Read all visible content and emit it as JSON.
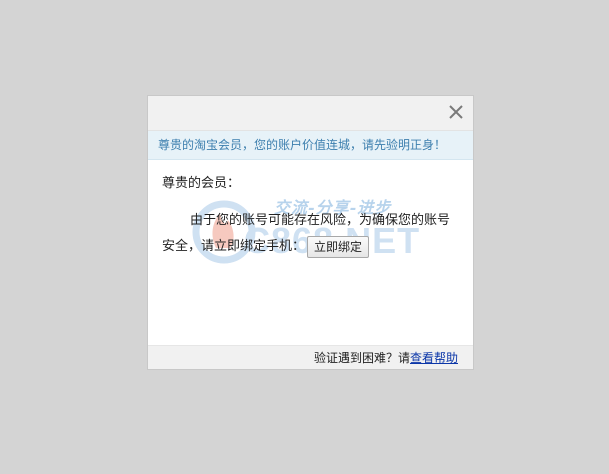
{
  "dialog": {
    "close_icon": "close-x-icon",
    "notice_text": "尊贵的淘宝会员，您的账户价值连城，请先验明正身！",
    "greeting": "尊贵的会员：",
    "message": "由于您的账号可能存在风险，为确保您的账号安全，请立即绑定手机：",
    "bind_button_label": "立即绑定",
    "footer_prefix": "验证遇到困难？请",
    "help_link_label": "查看帮助"
  },
  "watermark": {
    "slogan": "交流-分享-进步",
    "brand": "C868.NET"
  },
  "colors": {
    "page_background": "#d4d4d4",
    "notice_background": "#e7f2f8",
    "notice_text": "#3d7fae",
    "link": "#0b36a8"
  }
}
